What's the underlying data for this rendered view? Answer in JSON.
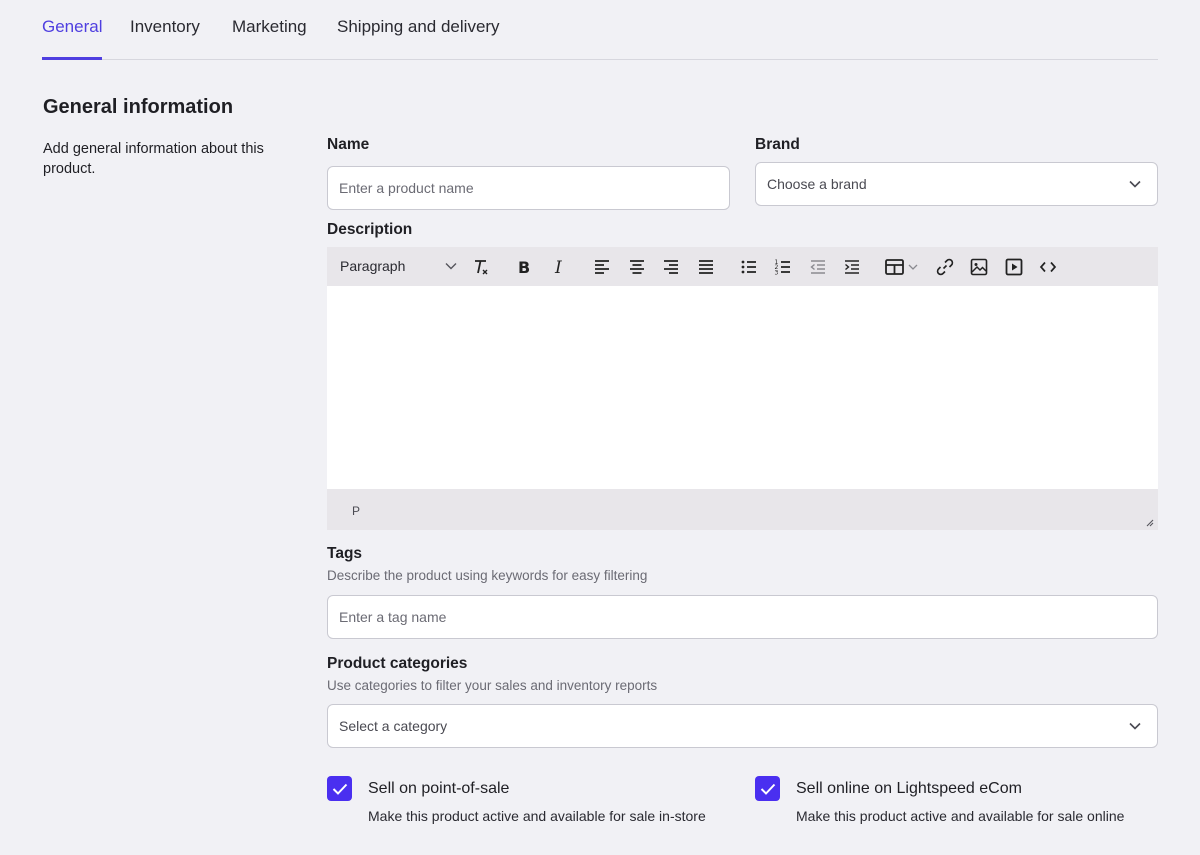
{
  "tabs": [
    {
      "label": "General",
      "active": true
    },
    {
      "label": "Inventory",
      "active": false
    },
    {
      "label": "Marketing",
      "active": false
    },
    {
      "label": "Shipping and delivery",
      "active": false
    }
  ],
  "section": {
    "title": "General information",
    "description": "Add general information about this product."
  },
  "name": {
    "label": "Name",
    "placeholder": "Enter a product name",
    "value": ""
  },
  "brand": {
    "label": "Brand",
    "selected": "Choose a brand"
  },
  "description": {
    "label": "Description",
    "block_format": "Paragraph",
    "status_path": "P",
    "toolbar_icons": [
      "clear-format-icon",
      "bold-icon",
      "italic-icon",
      "align-left-icon",
      "align-center-icon",
      "align-right-icon",
      "align-justify-icon",
      "bullet-list-icon",
      "numbered-list-icon",
      "outdent-icon",
      "indent-icon",
      "table-icon",
      "link-icon",
      "image-icon",
      "media-icon",
      "code-icon"
    ]
  },
  "tags": {
    "label": "Tags",
    "hint": "Describe the product using keywords for easy filtering",
    "placeholder": "Enter a tag name"
  },
  "categories": {
    "label": "Product categories",
    "hint": "Use categories to filter your sales and inventory reports",
    "selected": "Select a category"
  },
  "pos": {
    "title": "Sell on point-of-sale",
    "description": "Make this product active and available for sale in-store",
    "checked": true
  },
  "ecom": {
    "title": "Sell online on Lightspeed eCom",
    "description": "Make this product active and available for sale online",
    "checked": true
  },
  "colors": {
    "accent": "#4f3fe0",
    "checkbox": "#4a2ff0",
    "background": "#f1f1f5"
  }
}
